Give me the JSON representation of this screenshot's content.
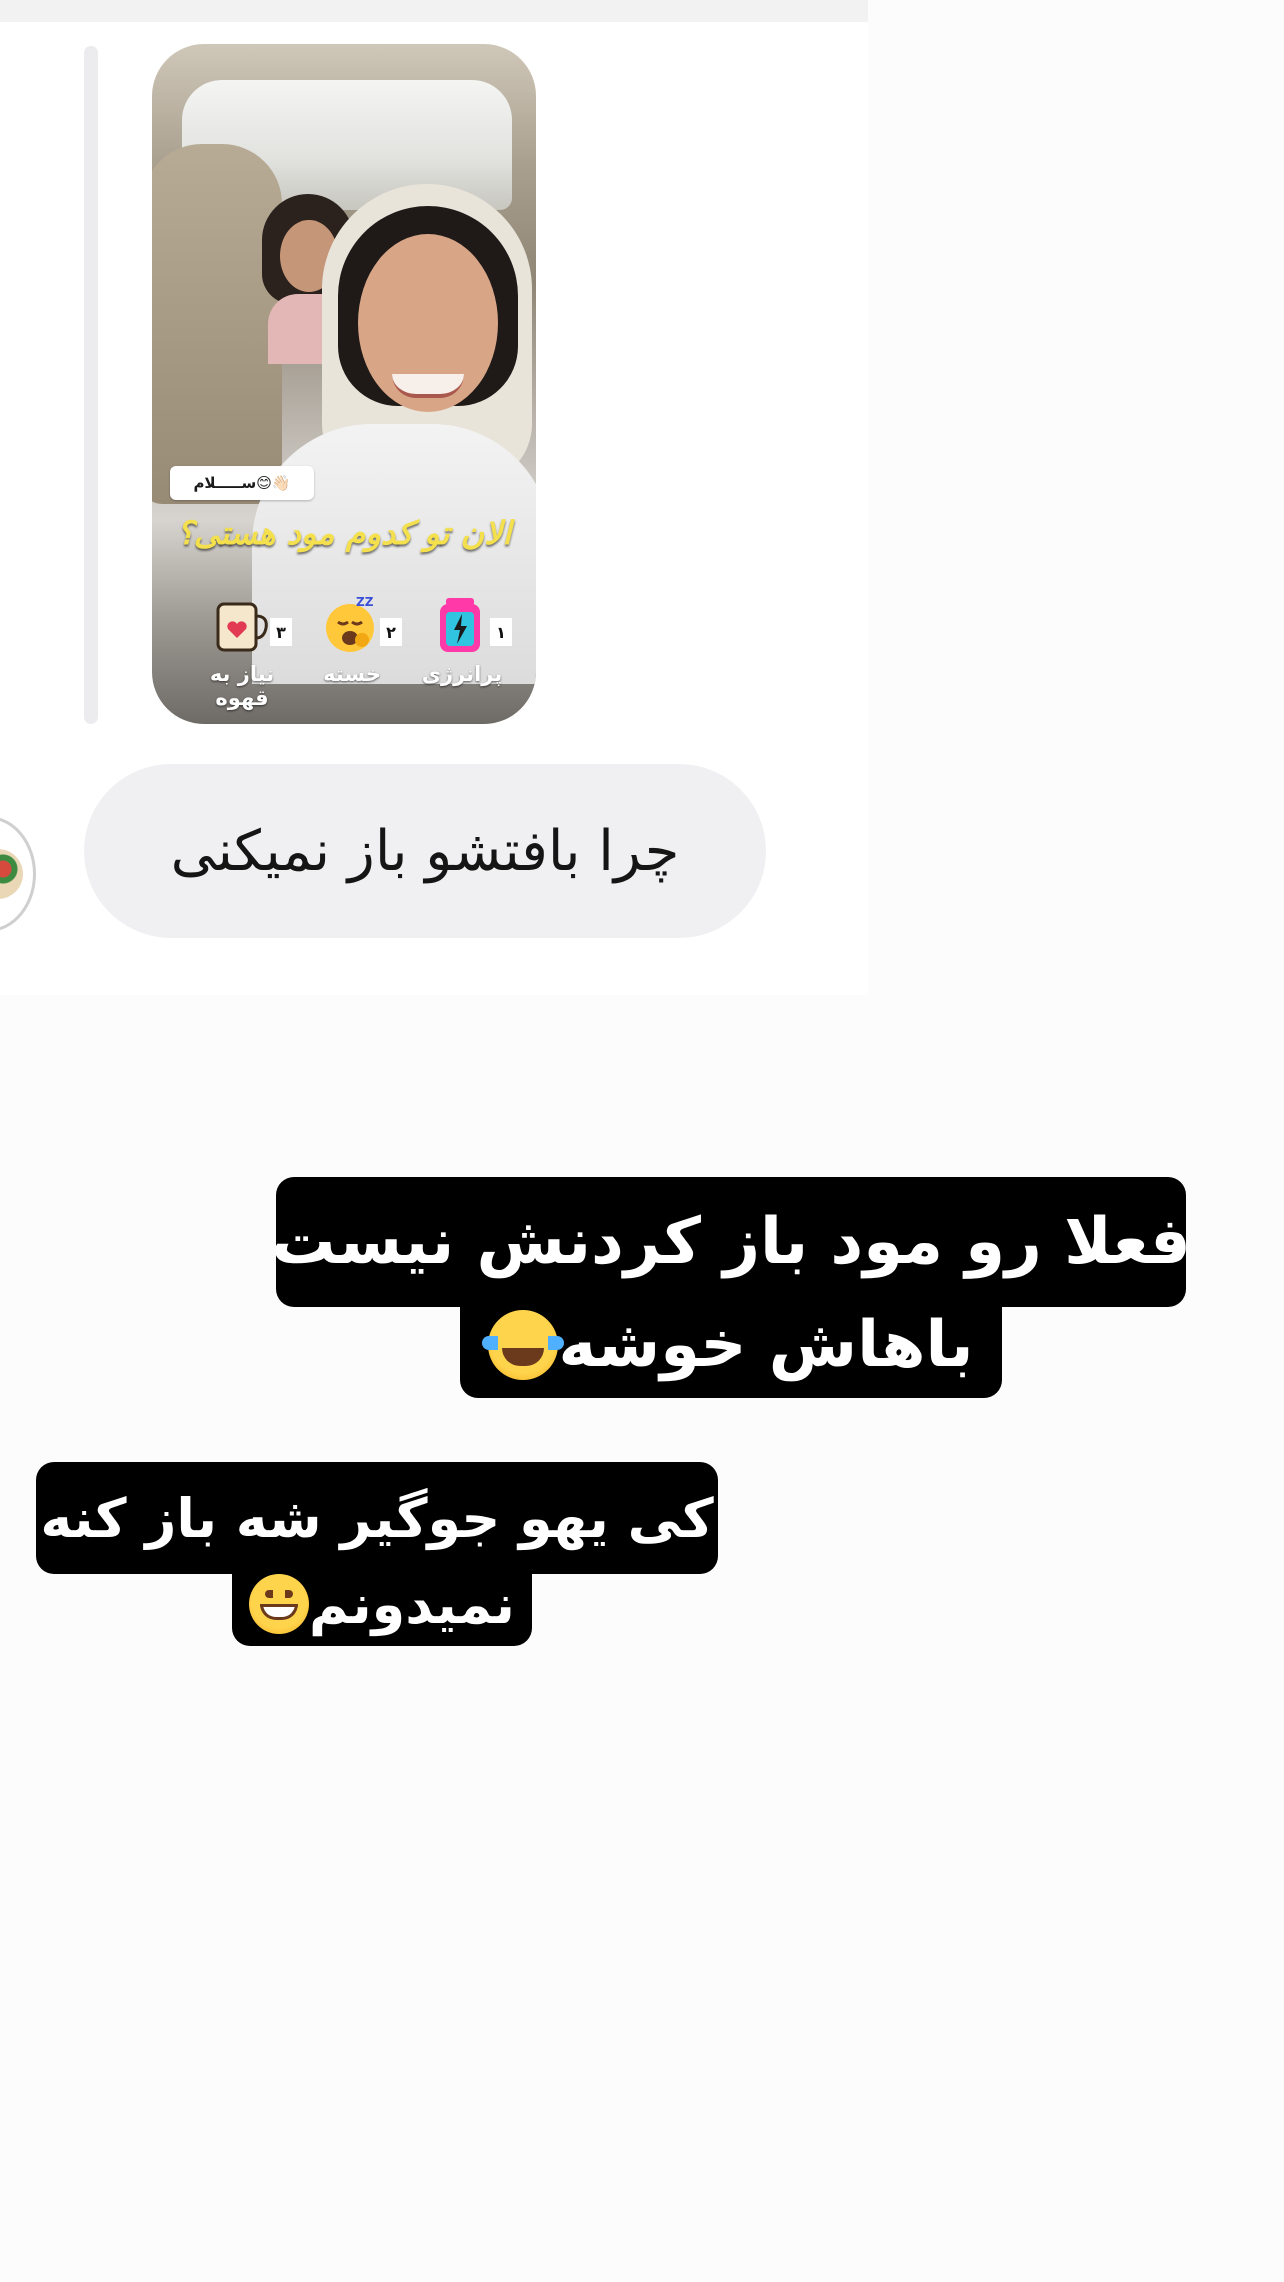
{
  "story_reply": {
    "sticker_text": "ســـــلام😊👋🏻",
    "poll": {
      "question": "الان تو کدوم مود هستی؟",
      "options": [
        {
          "number": "١",
          "label": "پرانرژی",
          "icon": "battery-icon"
        },
        {
          "number": "٢",
          "label": "خسته",
          "icon": "yawning-sleepy-face-icon"
        },
        {
          "number": "٣",
          "label": "نیاز به قهوه",
          "icon": "coffee-mug-heart-icon"
        }
      ]
    }
  },
  "message": {
    "text": "چرا بافتشو باز نمیکنی"
  },
  "captions": {
    "caption_1": {
      "line_1": "فعلا رو مود باز کردنش نیست",
      "line_2": "باهاش خوشه",
      "emoji": "face-with-tears-of-joy-icon"
    },
    "caption_2": {
      "line_1": "کی یهو جوگیر شه باز کنه",
      "line_2": "نمیدونم",
      "emoji": "grinning-face-icon"
    }
  },
  "colors": {
    "poll_question": "#f4e04d",
    "bubble": "#f0f0f2",
    "caption_background": "#000000",
    "caption_text": "#ffffff"
  }
}
